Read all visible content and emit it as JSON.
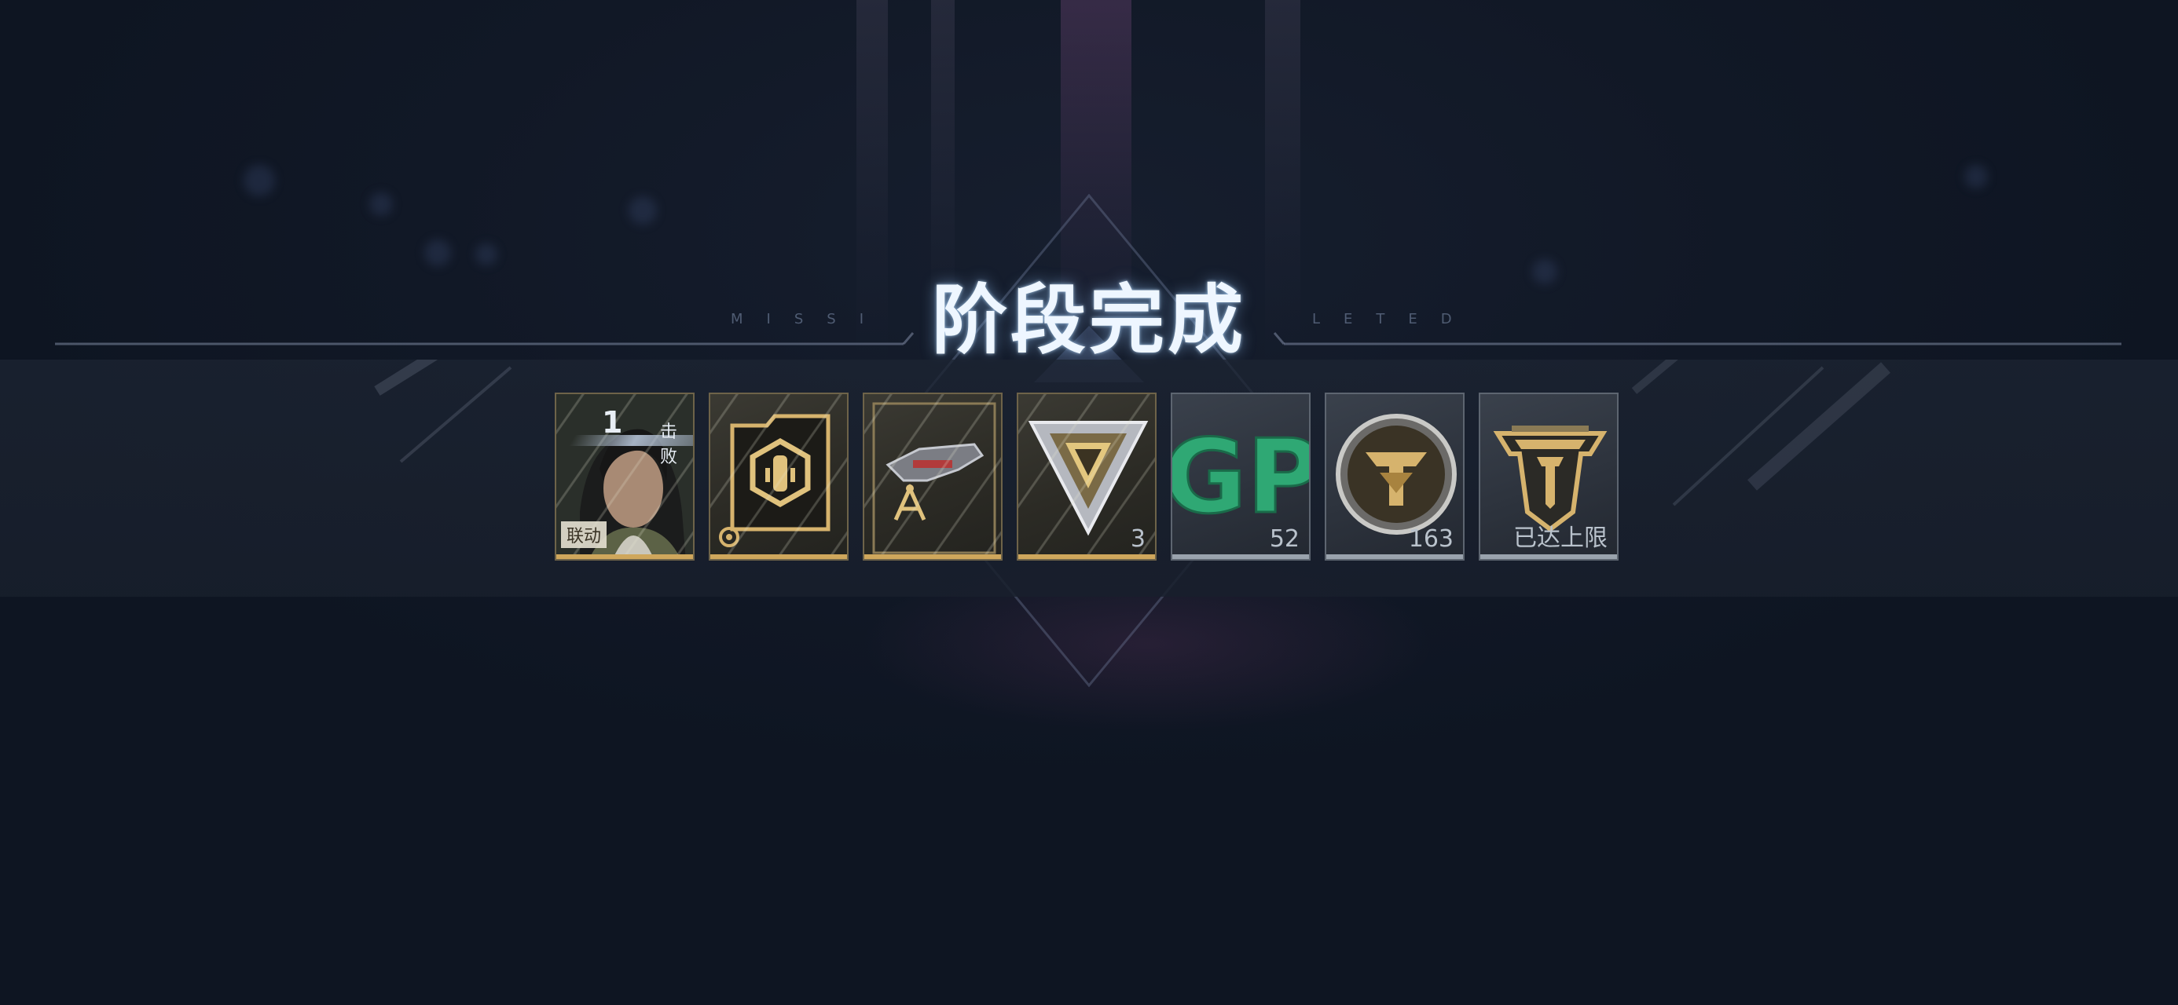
{
  "header": {
    "title": "阶段完成",
    "subtitle_left": "MISSI",
    "subtitle_right": "LETED"
  },
  "colors": {
    "background": "#111826",
    "title": "#eef6ff",
    "gold_accent": "#cfa75c",
    "silver_accent": "#9aa3ad",
    "gp_green": "#2fa874"
  },
  "rewards": [
    {
      "icon": "character-portrait-icon",
      "rarity": "gold",
      "count": "1",
      "count_label": "击败",
      "tag": "联动"
    },
    {
      "icon": "ammo-folder-icon",
      "rarity": "gold",
      "badge_icon": "gear-badge-icon"
    },
    {
      "icon": "weapon-blueprint-icon",
      "rarity": "gold"
    },
    {
      "icon": "triangle-emblem-icon",
      "rarity": "gold",
      "quantity": "3"
    },
    {
      "icon": "gp-currency-icon",
      "rarity": "silver",
      "quantity": "52",
      "label": "GP"
    },
    {
      "icon": "gold-coin-icon",
      "rarity": "silver",
      "quantity": "163"
    },
    {
      "icon": "rank-crest-icon",
      "rarity": "silver",
      "quantity": "已达上限"
    }
  ]
}
